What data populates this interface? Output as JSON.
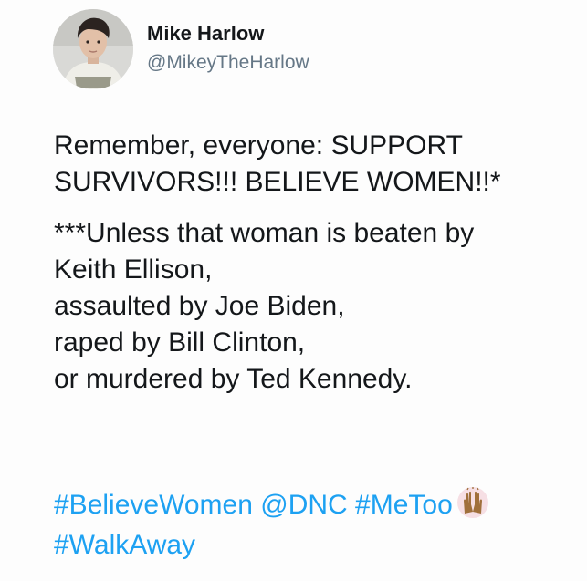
{
  "user": {
    "display_name": "Mike Harlow",
    "handle": "@MikeyTheHarlow"
  },
  "tweet": {
    "line1": "Remember, everyone: SUPPORT",
    "line2": "SURVIVORS!!! BELIEVE WOMEN!!*",
    "line3": "***Unless that woman is beaten by",
    "line4": "Keith Ellison,",
    "line5": "assaulted by Joe Biden,",
    "line6": "raped by Bill Clinton,",
    "line7": "or murdered by Ted Kennedy."
  },
  "tags": {
    "believe_women": "#BelieveWomen",
    "dnc": "@DNC",
    "metoo": "#MeToo",
    "walkaway": "#WalkAway"
  },
  "colors": {
    "link": "#1da1f2",
    "text": "#14171a",
    "muted": "#657786"
  },
  "icons": {
    "emoji": "raised-hands-emoji"
  }
}
